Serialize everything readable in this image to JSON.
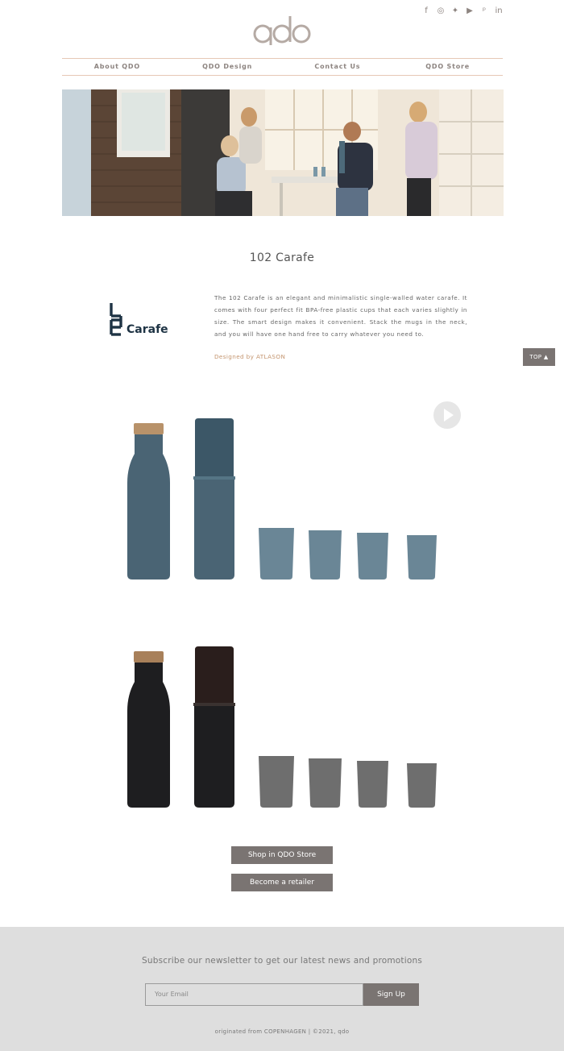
{
  "social": [
    {
      "name": "facebook-icon",
      "glyph": "f"
    },
    {
      "name": "instagram-icon",
      "glyph": "◎"
    },
    {
      "name": "twitter-icon",
      "glyph": "✦"
    },
    {
      "name": "youtube-icon",
      "glyph": "▶"
    },
    {
      "name": "pinterest-icon",
      "glyph": "ᵖ"
    },
    {
      "name": "linkedin-icon",
      "glyph": "in"
    }
  ],
  "nav": [
    "About QDO",
    "QDO Design",
    "Contact Us",
    "QDO Store"
  ],
  "product": {
    "title": "102 Carafe",
    "logo_text": "Carafe",
    "description": "The 102 Carafe is an elegant and minimalistic single-walled water carafe. It comes with four perfect fit BPA-free plastic cups that each varies slightly in size. The smart design makes it convenient. Stack the mugs in the neck, and you will have one hand free to carry whatever you need to.",
    "designer": "Designed by ATLASON"
  },
  "top_button": "TOP",
  "buttons": {
    "shop": "Shop in QDO Store",
    "retailer": "Become a retailer"
  },
  "footer": {
    "newsletter": "Subscribe our newsletter to get our latest news and promotions",
    "email_placeholder": "Your Email",
    "signup": "Sign Up",
    "copyright": "originated from COPENHAGEN  |  ©2021, qdo"
  },
  "colors": {
    "accent": "#c4956f",
    "button": "#7a7472",
    "footer_bg": "#dedede",
    "blue_product": "#4a6474",
    "black_product": "#1e1e20"
  }
}
